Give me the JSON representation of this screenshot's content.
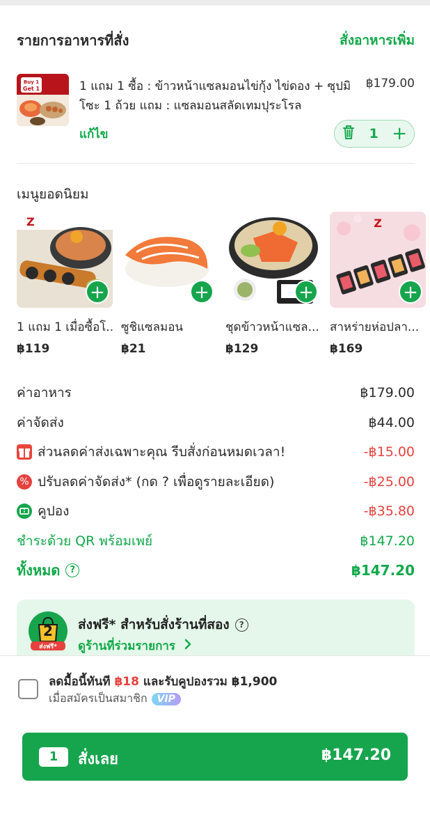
{
  "order_section": {
    "title": "รายการอาหารที่สั่ง",
    "add_more_label": "สั่งอาหารเพิ่ม"
  },
  "cart_item": {
    "image_label": "ข้าวหน้าแซลมอนไข่กุ้ง",
    "badge_text": "Buy 1 Get 1",
    "name": "1 แถม 1 ซื้อ : ข้าวหน้าแซลมอนไข่กุ้ง ไข่ดอง + ซุปมิโซะ 1 ถ้วย  แถม : แซลมอนสลัดเทมปุระโรล",
    "price": "฿179.00",
    "edit_label": "แก้ไข",
    "quantity": "1"
  },
  "popular": {
    "title": "เมนูยอดนิยม",
    "items": [
      {
        "name": "1 แถม 1 เมื่อซื้อโ...",
        "price": "฿119"
      },
      {
        "name": "ซูชิแซลมอน",
        "price": "฿21"
      },
      {
        "name": "ชุดข้าวหน้าแซล...",
        "price": "฿129"
      },
      {
        "name": "สาหร่ายห่อปลา...",
        "price": "฿169"
      }
    ]
  },
  "summary": {
    "food_label": "ค่าอาหาร",
    "food_value": "฿179.00",
    "delivery_label": "ค่าจัดส่ง",
    "delivery_value": "฿44.00",
    "special_label": "ส่วนลดค่าส่งเฉพาะคุณ รีบสั่งก่อนหมดเวลา!",
    "special_value": "-฿15.00",
    "adjust_label": "ปรับลดค่าจัดส่ง* (กด ? เพื่อดูรายละเอียด)",
    "adjust_value": "-฿25.00",
    "coupon_label": "คูปอง",
    "coupon_value": "-฿35.80",
    "payment_label": "ชำระด้วย QR พร้อมเพย์",
    "payment_value": "฿147.20",
    "total_label": "ทั้งหมด",
    "total_value": "฿147.20"
  },
  "promo": {
    "title": "ส่งฟรี* สำหรับสั่งร้านที่สอง",
    "link": "ดูร้านที่ร่วมรายการ",
    "badge_number": "2",
    "badge_text": "ส่งฟรี*"
  },
  "membership": {
    "line_prefix": "ลดมื้อนี้ทันที ",
    "discount": "฿18",
    "line_suffix": " และรับคูปองรวม ฿1,900",
    "line2": "เมื่อสมัครเป็นสมาชิก",
    "vip": "VIP"
  },
  "order_button": {
    "count": "1",
    "label": "สั่งเลย",
    "total": "฿147.20"
  },
  "colors": {
    "accent_green": "#16a54d",
    "discount_red": "#e5423e",
    "promo_bg": "#e5f7ea"
  }
}
